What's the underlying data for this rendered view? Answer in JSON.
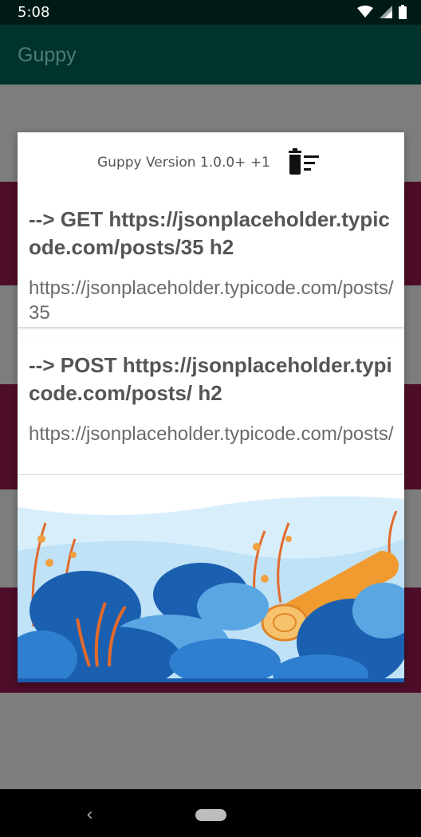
{
  "status": {
    "time": "5:08"
  },
  "appbar": {
    "title": "Guppy"
  },
  "dialog": {
    "version": "Guppy Version 1.0.0+ +1",
    "requests": [
      {
        "headline": "--> GET https://jsonplaceholder.typicode.com/posts/35 h2",
        "url": "https://jsonplaceholder.typicode.com/posts/35"
      },
      {
        "headline": "--> POST https://jsonplaceholder.typicode.com/posts/ h2",
        "url": "https://jsonplaceholder.typicode.com/posts/"
      }
    ]
  },
  "icons": [
    "wifi-icon",
    "signal-icon",
    "battery-icon",
    "delete-sweep-icon",
    "back-icon",
    "home-icon"
  ],
  "colors": {
    "appbar": "#00332b",
    "statusbar": "#001a15",
    "scrim": "#7d7d7d",
    "list_strip": "#4d0d28",
    "dialog": "#ffffff"
  }
}
